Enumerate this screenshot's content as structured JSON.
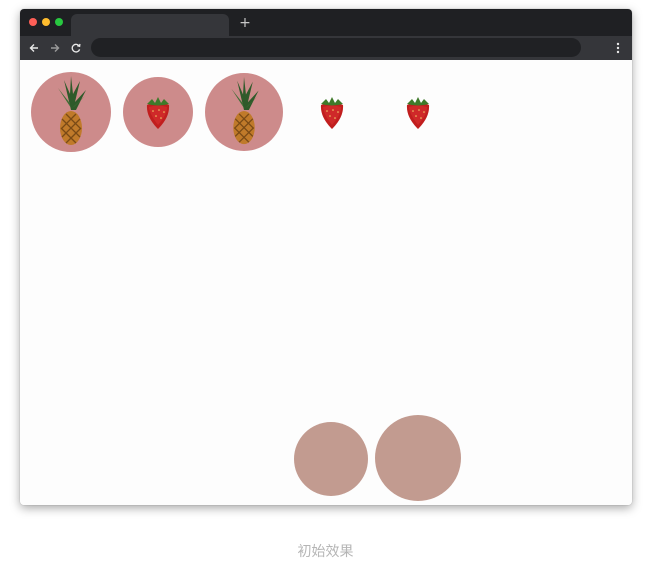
{
  "browser": {
    "traffic_lights": {
      "close_color": "#fe5f57",
      "minimize_color": "#febc2e",
      "maximize_color": "#28c840"
    },
    "new_tab_label": "+",
    "nav": {
      "back_icon": "arrow-left-icon",
      "forward_icon": "arrow-right-icon",
      "reload_icon": "reload-icon"
    },
    "address_value": "",
    "menu_icon": "vertical-dots-icon"
  },
  "page": {
    "background_color": "#fdfdfd",
    "fruits": [
      {
        "kind": "pineapple",
        "icon": "pineapple-icon",
        "background_color": "#cd8b8b"
      },
      {
        "kind": "strawberry",
        "icon": "strawberry-icon",
        "background_color": "#cd8b8b"
      },
      {
        "kind": "pineapple",
        "icon": "pineapple-icon",
        "background_color": "#cd8b8b"
      },
      {
        "kind": "strawberry",
        "icon": "strawberry-icon",
        "background_color": "none"
      },
      {
        "kind": "strawberry",
        "icon": "strawberry-icon",
        "background_color": "none"
      }
    ],
    "bottom_circles_color": "#c29b90"
  },
  "caption": "初始效果"
}
